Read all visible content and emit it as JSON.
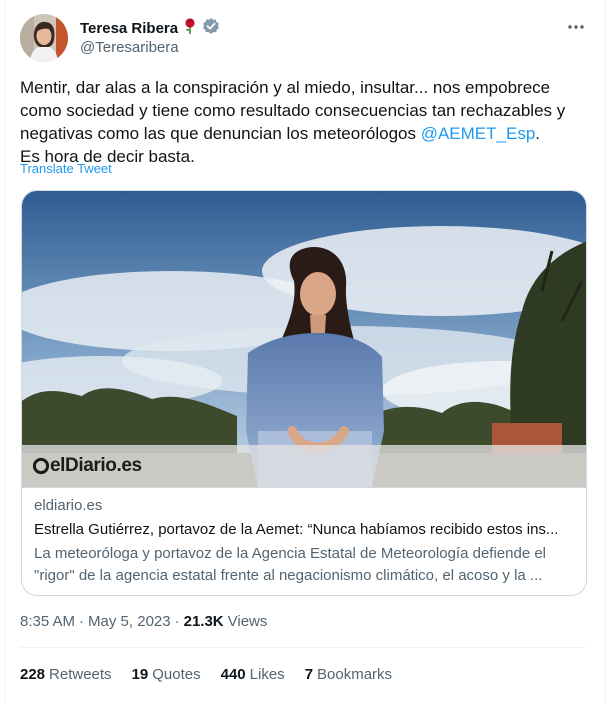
{
  "author": {
    "display_name": "Teresa Ribera",
    "handle": "@Teresaribera",
    "emoji": "rose-emoji",
    "verified_badge": "verified-badge-icon"
  },
  "tweet": {
    "line1": "Mentir, dar alas a la conspiración y al miedo, insultar... nos empobrece",
    "line2": "como sociedad y tiene como resultado consecuencias tan rechazables y",
    "line3_pre": "negativas como las que denuncian los meteorólogos ",
    "mention": "@AEMET_Esp",
    "line3_post": ".",
    "line4": "Es hora de decir basta.",
    "translate_label": "Translate Tweet"
  },
  "card": {
    "logo_text": "elDiario.es",
    "domain": "eldiario.es",
    "title": "Estrella Gutiérrez, portavoz de la Aemet: “Nunca habíamos recibido estos ins...",
    "description_line1": "La meteoróloga y portavoz de la Agencia Estatal de Meteorología defiende el",
    "description_line2": "\"rigor\" de la agencia estatal frente al negacionismo climático, el acoso y la ..."
  },
  "meta": {
    "time": "8:35 AM",
    "separator": "·",
    "date": "May 5, 2023",
    "views_count": "21.3K",
    "views_label": "Views"
  },
  "stats": [
    {
      "count": "228",
      "label": "Retweets"
    },
    {
      "count": "19",
      "label": "Quotes"
    },
    {
      "count": "440",
      "label": "Likes"
    },
    {
      "count": "7",
      "label": "Bookmarks"
    }
  ],
  "colors": {
    "accent": "#1d9bf0",
    "text_primary": "#0f1419",
    "text_secondary": "#536471",
    "border": "#cfd9de"
  }
}
